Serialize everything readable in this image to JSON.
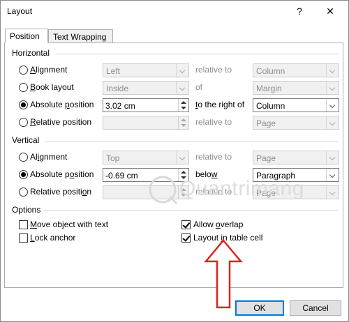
{
  "window": {
    "title": "Layout",
    "help_glyph": "?",
    "close_glyph": "✕"
  },
  "tabs": [
    {
      "label": "Position",
      "active": true
    },
    {
      "label": "Text Wrapping",
      "active": false
    }
  ],
  "horizontal": {
    "title": "Horizontal",
    "rows": [
      {
        "label_pre": "",
        "label_key": "A",
        "label_post": "lignment",
        "selected": false,
        "value": "Left",
        "relation": "relative to",
        "target": "Column",
        "enabled": false
      },
      {
        "label_pre": "",
        "label_key": "B",
        "label_post": "ook layout",
        "selected": false,
        "value": "Inside",
        "relation": "of",
        "target": "Margin",
        "enabled": false
      },
      {
        "label_pre": "Absolute ",
        "label_key": "p",
        "label_post": "osition",
        "selected": true,
        "value": "3.02 cm",
        "relation_pre": "",
        "relation_key": "t",
        "relation_post": "o the right of",
        "relation": "to the right of",
        "target": "Column",
        "enabled": true
      },
      {
        "label_pre": "",
        "label_key": "R",
        "label_post": "elative position",
        "selected": false,
        "value": "",
        "relation": "relative to",
        "target": "Page",
        "enabled": false
      }
    ]
  },
  "vertical": {
    "title": "Vertical",
    "rows": [
      {
        "label_pre": "Al",
        "label_key": "i",
        "label_post": "gnment",
        "selected": false,
        "value": "Top",
        "relation": "relative to",
        "target": "Page",
        "enabled": false
      },
      {
        "label_pre": "Absolute p",
        "label_key": "o",
        "label_post": "sition",
        "selected": true,
        "value": "-0.69 cm",
        "relation_pre": "belo",
        "relation_key": "w",
        "relation_post": "",
        "relation": "below",
        "target": "Paragraph",
        "enabled": true
      },
      {
        "label_pre": "Relative positi",
        "label_key": "o",
        "label_post": "n",
        "selected": false,
        "value": "",
        "relation": "relative to",
        "target": "Page",
        "enabled": false
      }
    ]
  },
  "options": {
    "title": "Options",
    "items": [
      {
        "label_pre": "",
        "label_key": "M",
        "label_post": "ove object with text",
        "checked": false
      },
      {
        "label_pre": "",
        "label_key": "L",
        "label_post": "ock anchor",
        "checked": false
      },
      {
        "label_pre": "Allow ",
        "label_key": "o",
        "label_post": "verlap",
        "checked": true
      },
      {
        "label_pre": "Layout ",
        "label_key": "i",
        "label_post": "n table cell",
        "checked": true
      }
    ]
  },
  "buttons": {
    "ok": "OK",
    "cancel": "Cancel"
  },
  "watermark": {
    "text": "Quantrimang"
  },
  "colors": {
    "arrow": "#e02020",
    "default_button_border": "#0078d7"
  }
}
